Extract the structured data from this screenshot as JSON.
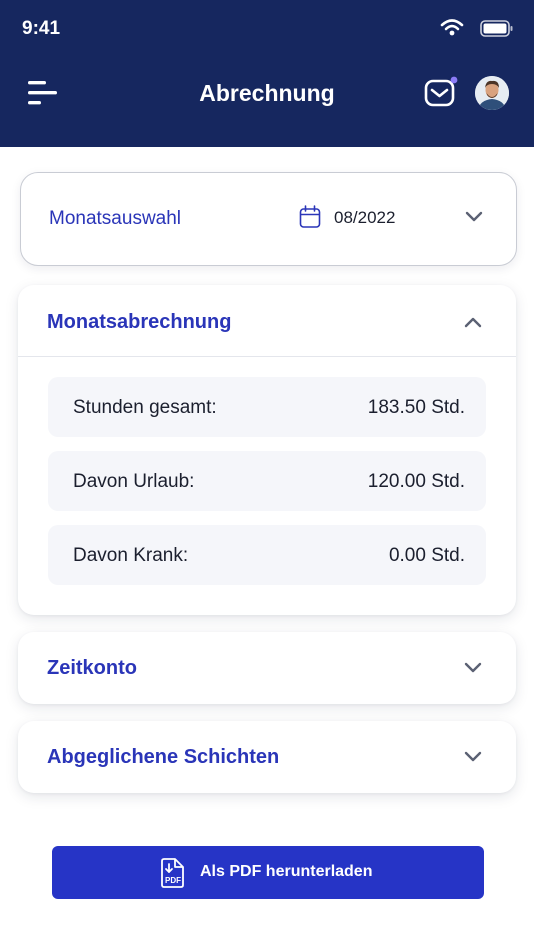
{
  "status_bar": {
    "time": "9:41"
  },
  "header": {
    "title": "Abrechnung"
  },
  "month_selector": {
    "label": "Monatsauswahl",
    "value": "08/2022"
  },
  "summary": {
    "title": "Monatsabrechnung",
    "rows": [
      {
        "label": "Stunden gesamt:",
        "value": "183.50 Std."
      },
      {
        "label": "Davon Urlaub:",
        "value": "120.00 Std."
      },
      {
        "label": "Davon Krank:",
        "value": "0.00 Std."
      }
    ]
  },
  "time_account": {
    "title": "Zeitkonto"
  },
  "shifts": {
    "title": "Abgeglichene Schichten"
  },
  "download": {
    "label": "Als PDF herunterladen",
    "icon_text": "PDF"
  },
  "colors": {
    "header_bg": "#16275f",
    "accent": "#2a35b8",
    "button_bg": "#2634c6",
    "notification_dot": "#8b7cf6",
    "row_bg": "#f5f6fa"
  },
  "icons": [
    "menu-icon",
    "mail-icon",
    "calendar-icon",
    "chevron-down-icon",
    "chevron-up-icon",
    "pdf-download-icon",
    "wifi-icon",
    "battery-icon"
  ]
}
